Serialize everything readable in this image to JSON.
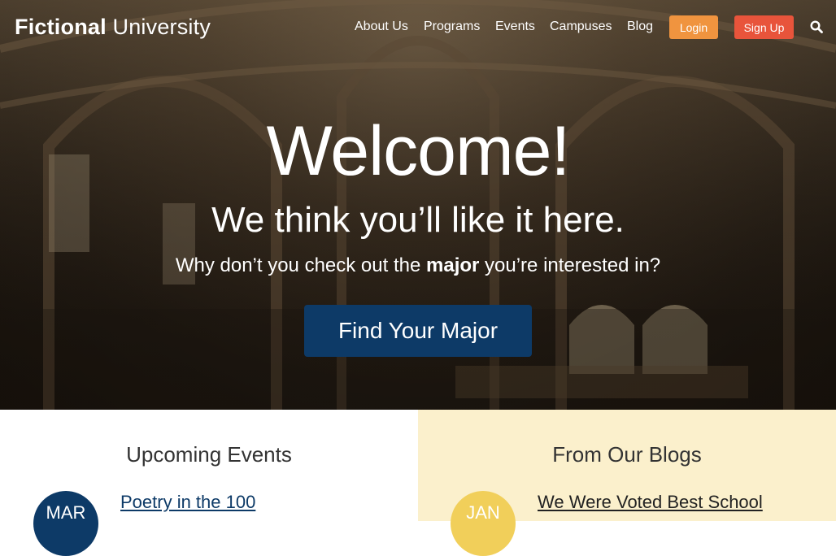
{
  "header": {
    "logo_bold": "Fictional",
    "logo_light": "University",
    "nav": [
      "About Us",
      "Programs",
      "Events",
      "Campuses",
      "Blog"
    ],
    "login_label": "Login",
    "signup_label": "Sign Up",
    "search_icon": "search-icon"
  },
  "hero": {
    "title": "Welcome!",
    "subtitle": "We think you’ll like it here.",
    "tagline_pre": "Why don’t you check out the ",
    "tagline_strong": "major",
    "tagline_post": " you’re interested in?",
    "cta_label": "Find Your Major"
  },
  "events": {
    "heading": "Upcoming Events",
    "items": [
      {
        "month": "MAR",
        "title": "Poetry in the 100"
      }
    ]
  },
  "blogs": {
    "heading": "From Our Blogs",
    "items": [
      {
        "month": "JAN",
        "title": "We Were Voted Best School"
      }
    ]
  },
  "colors": {
    "primary_blue": "#0d3a67",
    "login_orange": "#f0943f",
    "signup_red": "#e8543b",
    "blog_bg": "#fbf0cc",
    "blog_date": "#f1cf5a"
  }
}
